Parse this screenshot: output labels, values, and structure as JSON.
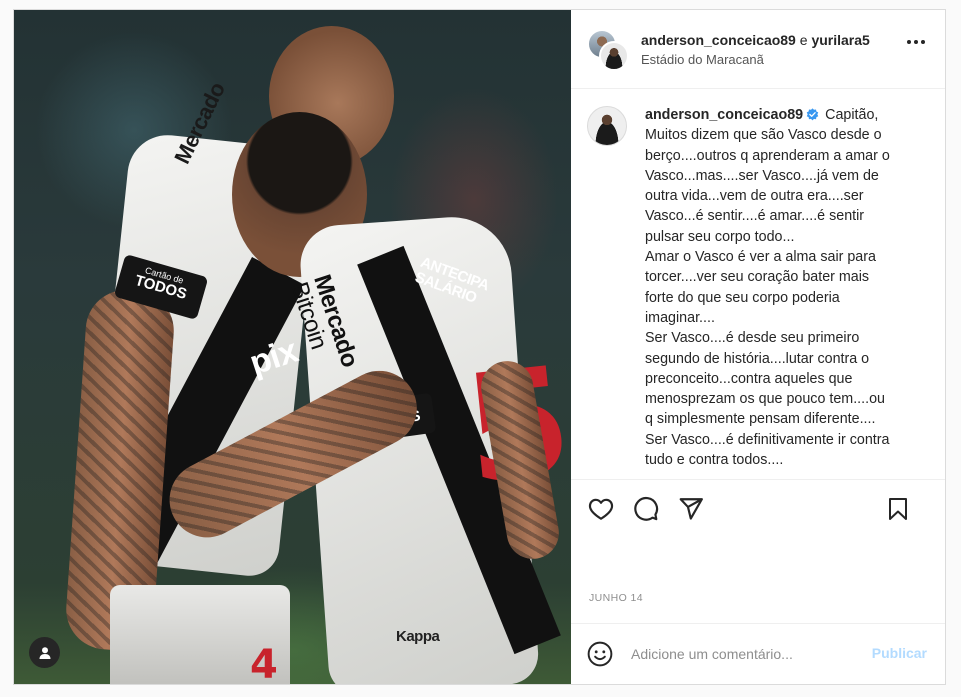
{
  "header": {
    "username1": "anderson_conceicao89",
    "conjunction": " e ",
    "username2": "yurilara5",
    "location": "Estádio do Maracanã"
  },
  "caption": {
    "username": "anderson_conceicao89",
    "lines": [
      "Capitão,",
      "Muitos dizem que são Vasco desde o",
      "berço....outros q aprenderam a amar o",
      "Vasco...mas....ser Vasco....já vem de",
      "outra vida...vem de outra era....ser",
      "Vasco...é sentir....é amar....é sentir",
      "pulsar seu corpo todo...",
      "Amar o Vasco é ver a alma sair para",
      "torcer....ver seu coração bater mais",
      "forte do que seu corpo poderia",
      "imaginar....",
      "Ser Vasco....é desde seu primeiro",
      "segundo de história....lutar contra o",
      "preconceito...contra aqueles que",
      "menosprezam os que pouco tem....ou",
      "q simplesmente pensam diferente....",
      "Ser Vasco....é definitivamente ir contra",
      "tudo e contra todos...."
    ]
  },
  "photo": {
    "sponsor_line1": "Mercado",
    "sponsor_line2": "Bitcoin",
    "badge_line1": "Cartão de",
    "badge_line2": "TODOS",
    "chest_text1": "ANTECIPA",
    "chest_text2": "SALÁRIO",
    "chest_text3": "pix",
    "shirt_number": "5",
    "shorts_number": "4",
    "brand": "Kappa"
  },
  "date": "JUNHO 14",
  "comment": {
    "placeholder": "Adicione um comentário...",
    "publish_label": "Publicar"
  },
  "colors": {
    "accent": "#0095f6",
    "publish_disabled": "#b3dbff",
    "verified": "#3897f0",
    "vasco_red": "#c8232c"
  },
  "icons": [
    "more-icon",
    "verified-icon",
    "heart-icon",
    "comment-icon",
    "share-icon",
    "bookmark-icon",
    "emoji-icon",
    "user-tag-icon"
  ]
}
